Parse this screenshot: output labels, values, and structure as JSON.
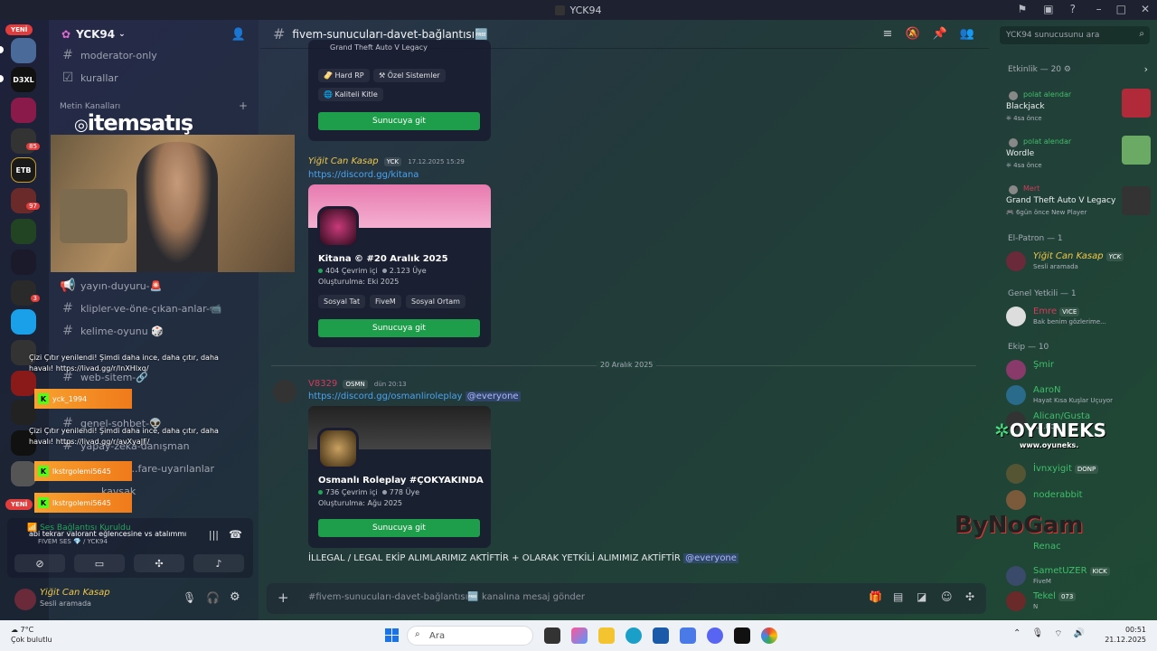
{
  "window": {
    "title": "YCK94"
  },
  "server": {
    "name": "YCK94",
    "new_label": "YENİ"
  },
  "rail": {
    "servers": [
      "D3XL",
      "ETB"
    ],
    "badges": [
      "85",
      "97",
      "3"
    ]
  },
  "channels": [
    {
      "name": "moderator-only"
    },
    {
      "name": "kurallar"
    },
    {
      "name": "yayın-duyuru-🚨"
    },
    {
      "name": "klipler-ve-öne-çıkan-anlar-📹"
    },
    {
      "name": "kelime-oyunu 🎲"
    },
    {
      "name": "web-sitem-🔗"
    },
    {
      "name": "genel-sohbet-👽"
    },
    {
      "name": "yapay-zeka-danışman"
    },
    {
      "name": "...fare-uyarılanlar"
    },
    {
      "name": "kavşak"
    }
  ],
  "category": {
    "name": "Metin Kanalları"
  },
  "overlay": {
    "brand": "itemsatış",
    "promo1": "Çizi Çıtır yenilendi! Şimdi daha ince, daha çıtır, daha havalı! https://livad.gg/r/lnXHlxq/",
    "promo2": "Çizi Çıtır yenilendi! Şimdi daha ince, daha çıtır, daha havalı! https://livad.gg/r/avXyaJF/",
    "donor1": "yck_1994",
    "donor2": "lkstrgolemi5645",
    "donor3": "lkstrgolemi5645",
    "overlay_note": "Ses Bağlantısı Kuruldu",
    "chat_note": "abi tekrar valorant eğlencesine vs atalımmı",
    "logo1": "OYUNEKS",
    "logo1_url": "www.oyuneks.",
    "logo2": "ByNoGam"
  },
  "voice": {
    "status": "Ses Bağlantısı Kuruldu",
    "sub": "FIVEM SES 💎 / YCK94"
  },
  "user": {
    "name": "Yiğit Can Kasap",
    "status": "Sesli aramada"
  },
  "chat": {
    "channel": "fivem-sunucuları-davet-bağlantısı🆓",
    "search_placeholder": "YCK94 sunucusunu ara",
    "card0": {
      "header": "Grand Theft Auto V Legacy",
      "tags": [
        "Hard RP",
        "Özel Sistemler",
        "Kaliteli Kitle"
      ],
      "button": "Sunucuya git"
    },
    "msg1": {
      "author": "Yiğit Can Kasap",
      "tag": "YCK",
      "time": "17.12.2025 15:29",
      "link": "https://discord.gg/kitana",
      "card": {
        "name": "Kitana © #20 Aralık 2025",
        "online": "404 Çevrim içi",
        "members": "2.123 Üye",
        "created": "Oluşturulma: Eki 2025",
        "tags": [
          "Sosyal Tat",
          "FiveM",
          "Sosyal Ortam"
        ],
        "button": "Sunucuya git"
      }
    },
    "date_sep": "20 Aralık 2025",
    "msg2": {
      "author": "V8329",
      "tag": "OSMN",
      "time": "dün 20:13",
      "link": "https://discord.gg/osmanliroleplay",
      "mention": "@everyone",
      "card": {
        "name": "Osmanlı Roleplay #ÇOKYAKINDA",
        "online": "736 Çevrim içi",
        "members": "778 Üye",
        "created": "Oluşturulma: Ağu 2025",
        "button": "Sunucuya git"
      },
      "text": "İLLEGAL / LEGAL EKİP ALIMLARIMIZ AKTİFTİR + OLARAK YETKİLİ ALIMIMIZ AKTİFTİR",
      "mention2": "@everyone"
    },
    "composer_placeholder": "#fivem-sunucuları-davet-bağlantısı🆓 kanalına mesaj gönder"
  },
  "members": {
    "activity_header": "Etkinlik — 20",
    "activities": [
      {
        "user": "polat alendar",
        "game": "Blackjack",
        "time": "4sa önce"
      },
      {
        "user": "polat alendar",
        "game": "Wordle",
        "time": "4sa önce"
      },
      {
        "user": "Mert",
        "game": "Grand Theft Auto V Legacy",
        "time": "6gün önce",
        "extra": "New Player"
      }
    ],
    "groups": [
      {
        "title": "El-Patron — 1",
        "items": [
          {
            "name": "Yiğit Can Kasap",
            "tag": "YCK",
            "status": "Sesli aramada"
          }
        ]
      },
      {
        "title": "Genel Yetkili — 1",
        "items": [
          {
            "name": "Emre",
            "tag": "VICE",
            "status": "Bak benim gözlerime..."
          }
        ]
      },
      {
        "title": "Ekip — 10",
        "items": [
          {
            "name": "Şmir",
            "status": ""
          },
          {
            "name": "AaroN",
            "status": "Hayat Kısa Kuşlar Uçuyor"
          },
          {
            "name": "Alican/Gusta",
            "status": "R.E.P.O."
          },
          {
            "name": "İvnxyigit",
            "tag": "DONP",
            "status": ""
          },
          {
            "name": "noderabbit",
            "status": ""
          },
          {
            "name": "Renac",
            "status": ""
          },
          {
            "name": "SametUZER",
            "tag": "KICK",
            "status": "FiveM"
          },
          {
            "name": "Tekel",
            "tag": "073",
            "status": "N"
          }
        ]
      }
    ]
  },
  "taskbar": {
    "temp": "7°C",
    "weather": "Çok bulutlu",
    "search": "Ara",
    "time": "00:51",
    "date": "21.12.2025"
  },
  "colors": {
    "accent_green": "#1e9e4a",
    "link_blue": "#4aa3f0",
    "gold": "#f0c84a"
  }
}
